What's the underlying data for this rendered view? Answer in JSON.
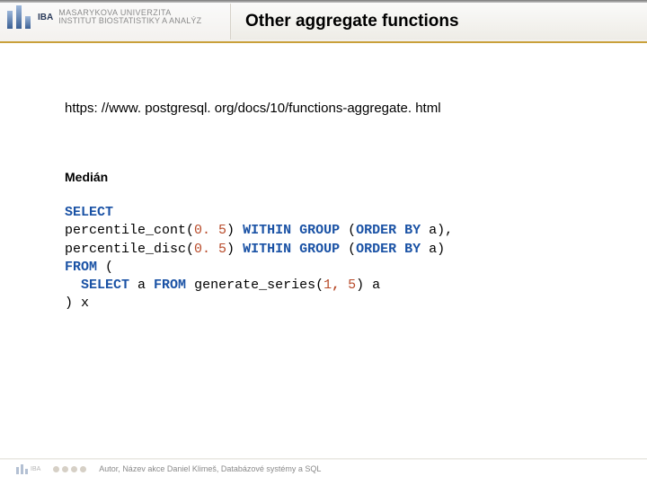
{
  "header": {
    "logo_label": "IBA",
    "institution_line1": "MASARYKOVA UNIVERZITA",
    "institution_line2": "INSTITUT BIOSTATISTIKY A ANALÝZ",
    "title": "Other aggregate functions"
  },
  "body": {
    "url": "https: //www. postgresql. org/docs/10/functions-aggregate. html",
    "section": "Medián",
    "code": {
      "l1_kw": "SELECT",
      "l2_a": "percentile_cont(",
      "l2_n": "0. 5",
      "l2_b": ") ",
      "l2_kw1": "WITHIN",
      "l2_c": " ",
      "l2_kw2": "GROUP",
      "l2_d": " (",
      "l2_kw3": "ORDER",
      "l2_e": " ",
      "l2_kw4": "BY",
      "l2_f": " a),",
      "l3_a": "percentile_disc(",
      "l3_n": "0. 5",
      "l3_b": ") ",
      "l3_kw1": "WITHIN",
      "l3_c": " ",
      "l3_kw2": "GROUP",
      "l3_d": " (",
      "l3_kw3": "ORDER",
      "l3_e": " ",
      "l3_kw4": "BY",
      "l3_f": " a)",
      "l4_kw": "FROM",
      "l4_a": " (",
      "l5_pad": "  ",
      "l5_kw": "SELECT",
      "l5_a": " a ",
      "l5_kw2": "FROM",
      "l5_b": " generate_series(",
      "l5_n1": "1",
      "l5_c": ", ",
      "l5_n2": "5",
      "l5_d": ") a",
      "l6_a": ") x"
    }
  },
  "footer": {
    "mini": "IBA",
    "text": "Autor, Název akce   Daniel Klimeš, Databázové systémy a SQL"
  }
}
